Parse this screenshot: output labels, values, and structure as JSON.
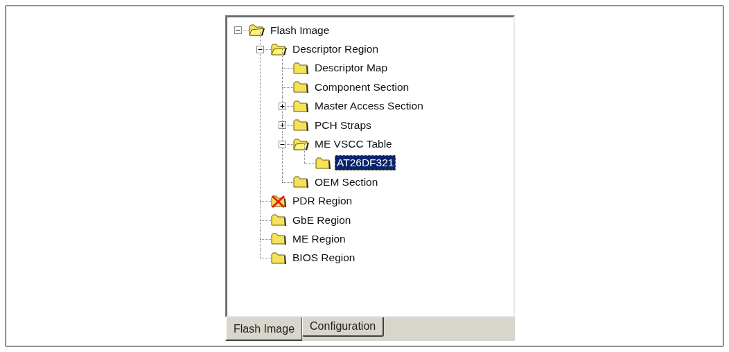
{
  "tree": [
    {
      "label": "Flash Image",
      "kind": "branch",
      "expanded": true,
      "selected": false,
      "error": false,
      "children": [
        {
          "label": "Descriptor Region",
          "kind": "branch",
          "expanded": true,
          "selected": false,
          "error": false,
          "children": [
            {
              "label": "Descriptor Map",
              "kind": "leaf",
              "expanded": false,
              "selected": false,
              "error": false
            },
            {
              "label": "Component Section",
              "kind": "leaf",
              "expanded": false,
              "selected": false,
              "error": false
            },
            {
              "label": "Master Access Section",
              "kind": "branch",
              "expanded": false,
              "selected": false,
              "error": false
            },
            {
              "label": "PCH Straps",
              "kind": "branch",
              "expanded": false,
              "selected": false,
              "error": false
            },
            {
              "label": "ME VSCC Table",
              "kind": "branch",
              "expanded": true,
              "selected": false,
              "error": false,
              "children": [
                {
                  "label": "AT26DF321",
                  "kind": "leaf",
                  "expanded": false,
                  "selected": true,
                  "error": false
                }
              ]
            },
            {
              "label": "OEM Section",
              "kind": "leaf",
              "expanded": false,
              "selected": false,
              "error": false
            }
          ]
        },
        {
          "label": "PDR Region",
          "kind": "leaf",
          "expanded": false,
          "selected": false,
          "error": true
        },
        {
          "label": "GbE Region",
          "kind": "leaf",
          "expanded": false,
          "selected": false,
          "error": false
        },
        {
          "label": "ME Region",
          "kind": "leaf",
          "expanded": false,
          "selected": false,
          "error": false
        },
        {
          "label": "BIOS Region",
          "kind": "leaf",
          "expanded": false,
          "selected": false,
          "error": false
        }
      ]
    }
  ],
  "tabs": [
    {
      "label": "Flash Image",
      "selected": true
    },
    {
      "label": "Configuration",
      "selected": false
    }
  ]
}
